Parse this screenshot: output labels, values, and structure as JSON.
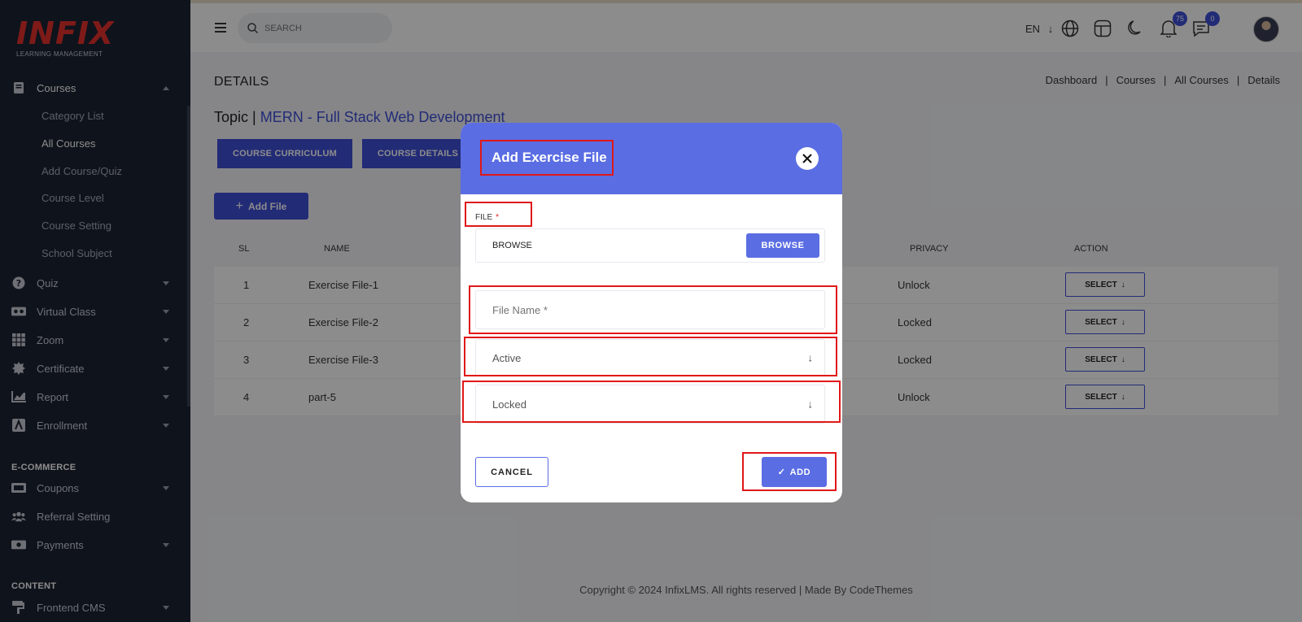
{
  "brand": {
    "logo_text": "INFIX",
    "logo_sub": "LEARNING MANAGEMENT",
    "accent": "#3f4fd8",
    "logo_color": "#e5322d"
  },
  "sidebar": {
    "courses": {
      "label": "Courses",
      "icon": "book-icon"
    },
    "course_sub": [
      "Category List",
      "All Courses",
      "Add Course/Quiz",
      "Course Level",
      "Course Setting",
      "School Subject"
    ],
    "items": [
      {
        "label": "Quiz",
        "icon": "question-icon"
      },
      {
        "label": "Virtual Class",
        "icon": "vr-icon"
      },
      {
        "label": "Zoom",
        "icon": "grid-icon"
      },
      {
        "label": "Certificate",
        "icon": "badge-icon"
      },
      {
        "label": "Report",
        "icon": "chart-icon"
      },
      {
        "label": "Enrollment",
        "icon": "enroll-icon"
      }
    ],
    "ecommerce_label": "E-COMMERCE",
    "ecommerce_items": [
      {
        "label": "Coupons",
        "icon": "ticket-icon"
      },
      {
        "label": "Referral Setting",
        "icon": "users-icon"
      },
      {
        "label": "Payments",
        "icon": "money-icon"
      }
    ],
    "content_label": "CONTENT",
    "content_items": [
      {
        "label": "Frontend CMS",
        "icon": "paint-roller-icon"
      }
    ]
  },
  "topbar": {
    "search_placeholder": "SEARCH",
    "lang": "EN",
    "notif_count": "75",
    "msg_count": "0"
  },
  "page": {
    "title": "DETAILS",
    "breadcrumb": [
      "Dashboard",
      "Courses",
      "All Courses",
      "Details"
    ],
    "topic_prefix": "Topic |",
    "topic_name": "MERN - Full Stack Web Development",
    "tabs": [
      "COURSE CURRICULUM",
      "COURSE DETAILS"
    ],
    "add_file_label": "Add File"
  },
  "table": {
    "headers": {
      "sl": "SL",
      "name": "NAME",
      "privacy": "PRIVACY",
      "action": "ACTION"
    },
    "rows": [
      {
        "sl": "1",
        "name": "Exercise File-1",
        "privacy": "Unlock"
      },
      {
        "sl": "2",
        "name": "Exercise File-2",
        "privacy": "Locked"
      },
      {
        "sl": "3",
        "name": "Exercise File-3",
        "privacy": "Locked"
      },
      {
        "sl": "4",
        "name": "part-5",
        "privacy": "Unlock"
      }
    ],
    "select_label": "SELECT"
  },
  "footer": {
    "text": "Copyright © 2024 InfixLMS. All rights reserved | Made By CodeThemes"
  },
  "modal": {
    "title": "Add Exercise File",
    "file_label": "FILE",
    "file_required": "*",
    "file_value": "BROWSE",
    "browse_label": "BROWSE",
    "file_name_placeholder": "File Name *",
    "status_value": "Active",
    "privacy_value": "Locked",
    "cancel_label": "CANCEL",
    "add_label": "ADD"
  }
}
